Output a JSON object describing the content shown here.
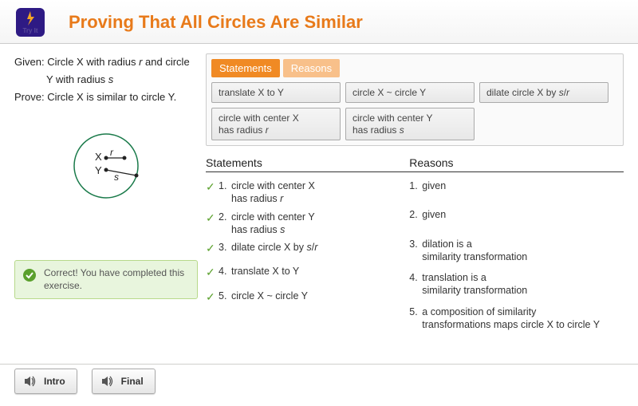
{
  "header": {
    "tryit_label": "Try It",
    "title": "Proving That All Circles Are Similar"
  },
  "given": {
    "label": "Given:",
    "line1_a": "Circle X with radius ",
    "line1_r": "r",
    "line1_b": " and circle",
    "line2_a": "Y with radius ",
    "line2_s": "s"
  },
  "prove": {
    "label": "Prove:",
    "text": "Circle X is similar to circle Y."
  },
  "diagram": {
    "X": "X",
    "Y": "Y",
    "r": "r",
    "s": "s"
  },
  "feedback": "Correct! You have completed this exercise.",
  "bank": {
    "tab_statements": "Statements",
    "tab_reasons": "Reasons",
    "tiles": [
      "translate X to Y",
      "circle X ~ circle Y",
      "dilate circle X by s/r",
      "circle with center X has radius r",
      "circle with center Y has radius s"
    ]
  },
  "proof": {
    "hdr_statements": "Statements",
    "hdr_reasons": "Reasons",
    "rows": [
      {
        "n": "1.",
        "s": "circle with center X has radius r",
        "s2": "",
        "r": "given"
      },
      {
        "n": "2.",
        "s": "circle with center Y has radius s",
        "s2": "",
        "r": "given"
      },
      {
        "n": "3.",
        "s": "dilate circle X by s/r",
        "s2": "",
        "r": "dilation is a similarity transformation"
      },
      {
        "n": "4.",
        "s": "translate X to Y",
        "s2": "",
        "r": "translation is a similarity transformation"
      },
      {
        "n": "5.",
        "s": "circle X ~ circle Y",
        "s2": "",
        "r": "a composition of similarity transformations maps circle X to circle Y"
      }
    ]
  },
  "footer": {
    "intro": "Intro",
    "final": "Final"
  }
}
